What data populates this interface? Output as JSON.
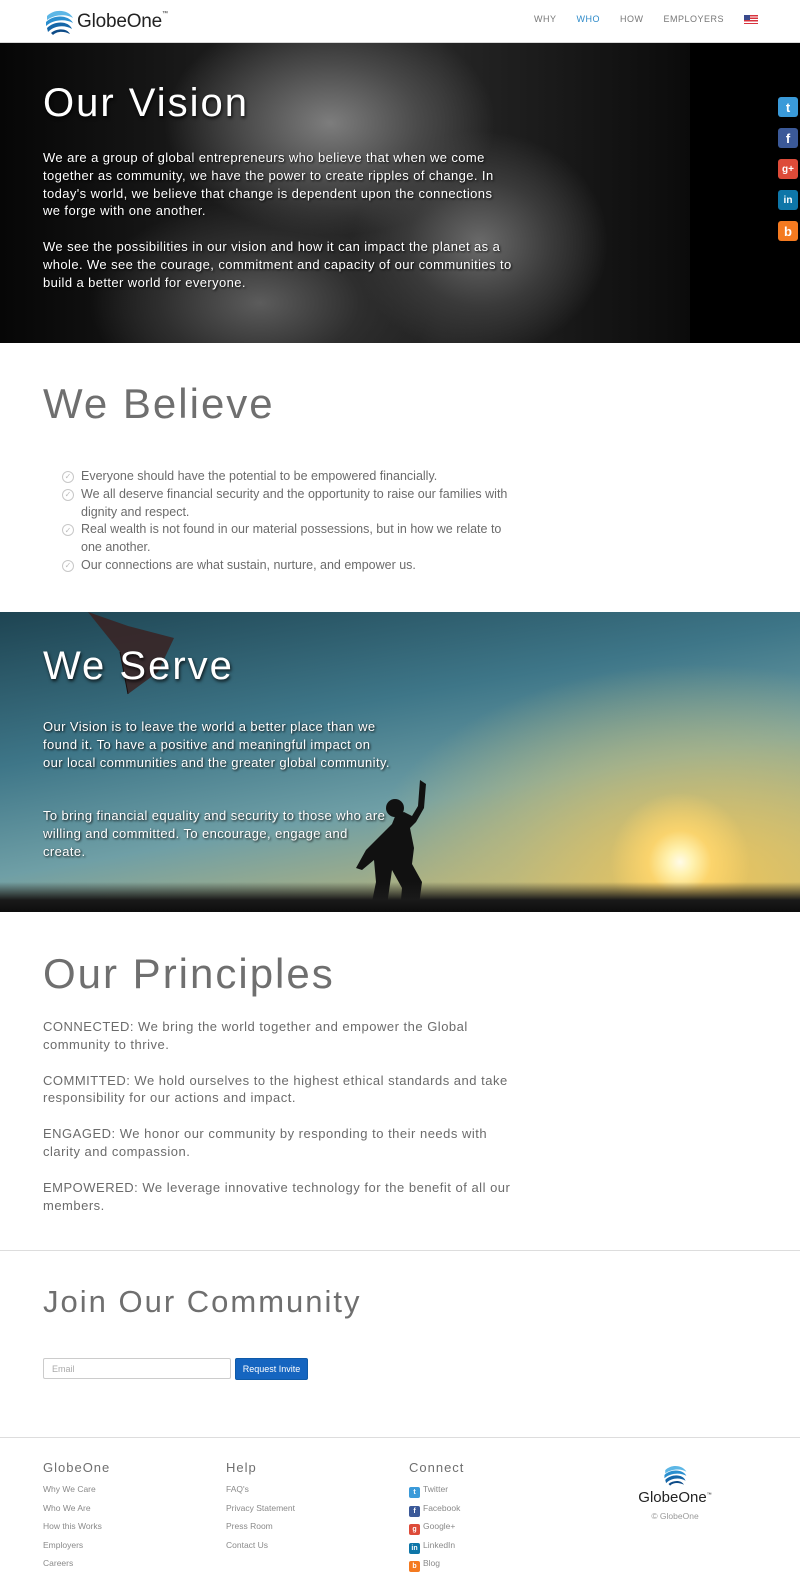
{
  "brand": {
    "name": "GlobeOne",
    "trademark": "™"
  },
  "nav": {
    "items": [
      {
        "label": "WHY",
        "active": false
      },
      {
        "label": "WHO",
        "active": true
      },
      {
        "label": "HOW",
        "active": false
      },
      {
        "label": "EMPLOYERS",
        "active": false
      }
    ],
    "language": "us-flag-icon"
  },
  "vision": {
    "title": "Our Vision",
    "p1": "We are a group of global entrepreneurs who believe that when we come together as community, we have the power to create ripples of change. In today's world, we believe that change is dependent upon the connections we forge with one another.",
    "p2": "We see the possibilities in our vision and how it can impact the planet as a whole. We see the courage, commitment and capacity of our communities to build a better world for everyone."
  },
  "social_sidebar": [
    {
      "icon": "twitter-icon",
      "glyph": "t",
      "color": "#3a9ad9"
    },
    {
      "icon": "facebook-icon",
      "glyph": "f",
      "color": "#3b5998"
    },
    {
      "icon": "googleplus-icon",
      "glyph": "g+",
      "color": "#dd4b39"
    },
    {
      "icon": "linkedin-icon",
      "glyph": "in",
      "color": "#0e76a8"
    },
    {
      "icon": "blog-icon",
      "glyph": "b",
      "color": "#f47a20"
    }
  ],
  "believe": {
    "title": "We Believe",
    "items": [
      "Everyone should have the potential to be empowered financially.",
      "We all deserve financial security and the opportunity to raise our families with dignity and respect.",
      "Real wealth is not found in our material possessions, but in how we relate to one another.",
      "Our connections are what sustain, nurture, and empower us."
    ]
  },
  "serve": {
    "title": "We Serve",
    "p1": "Our Vision is to leave the world a better place than we found it. To have a positive and meaningful impact on our local communities and the greater global community.",
    "p2": "To bring financial equality and security to those who are willing and committed. To encourage, engage and create."
  },
  "principles": {
    "title": "Our Principles",
    "items": [
      "CONNECTED: We bring the world together and empower the Global community to thrive.",
      "COMMITTED: We hold ourselves to the highest ethical standards and take responsibility for our actions and impact.",
      "ENGAGED: We honor our community by responding to their needs with clarity and compassion.",
      "EMPOWERED: We leverage innovative technology for the benefit of all our members."
    ]
  },
  "join": {
    "title": "Join Our Community",
    "email_placeholder": "Email",
    "button": "Request Invite"
  },
  "footer": {
    "col1": {
      "title": "GlobeOne",
      "links": [
        "Why We Care",
        "Who We Are",
        "How this Works",
        "Employers",
        "Careers"
      ]
    },
    "col2": {
      "title": "Help",
      "links": [
        "FAQ's",
        "Privacy Statement",
        "Press Room",
        "Contact Us"
      ]
    },
    "col3": {
      "title": "Connect",
      "links": [
        "Twitter",
        "Facebook",
        "Google+",
        "LinkedIn",
        "Blog"
      ]
    },
    "logo_name": "GlobeOne",
    "copyright": "© GlobeOne"
  }
}
